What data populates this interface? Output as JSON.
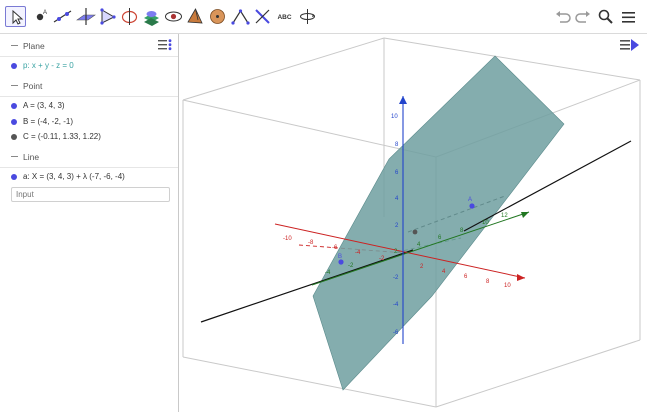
{
  "toolbar": {
    "tools": [
      "move-tool",
      "point-tool",
      "line-tool",
      "perpendicular-line-tool",
      "polygon-tool",
      "circle-tool",
      "intersect-tool",
      "plane-tool",
      "pyramid-tool",
      "sphere-tool",
      "angle-tool",
      "reflect-tool",
      "text-tool",
      "rotate-view-tool"
    ],
    "text_tool_label": "ABC"
  },
  "algebra": {
    "sections": [
      {
        "title": "Plane",
        "items": [
          {
            "text": "p: x + y - z = 0",
            "color": "#3aa3a3",
            "dot": "#4a4ae0"
          }
        ]
      },
      {
        "title": "Point",
        "items": [
          {
            "text": "A = (3, 4, 3)",
            "color": "#333333",
            "dot": "#4a4ae0"
          },
          {
            "text": "B = (-4, -2, -1)",
            "color": "#333333",
            "dot": "#4a4ae0"
          },
          {
            "text": "C = (-0.11, 1.33, 1.22)",
            "color": "#333333",
            "dot": "#555555"
          }
        ]
      },
      {
        "title": "Line",
        "items": [
          {
            "text": "a: X = (3, 4, 3) + λ (-7, -6, -4)",
            "color": "#333333",
            "dot": "#4a4ae0"
          }
        ]
      }
    ],
    "input_placeholder": "Input"
  },
  "graphics3d": {
    "x_axis_labels": [
      "-10",
      "-8",
      "-6",
      "-4",
      "-2",
      "2",
      "4",
      "6",
      "8",
      "10"
    ],
    "y_axis_labels": [
      "-4",
      "-2",
      "2",
      "4",
      "6",
      "8",
      "10",
      "12"
    ],
    "z_axis_labels": [
      "10",
      "8",
      "6",
      "4",
      "2",
      "-2",
      "-4",
      "-6"
    ],
    "point_labels": [
      "A",
      "B"
    ],
    "colors": {
      "x_axis": "#cc2222",
      "y_axis": "#227722",
      "z_axis": "#2244cc",
      "plane": "#6f9fa0",
      "line": "#111111",
      "point": "#4a4ae0"
    }
  }
}
